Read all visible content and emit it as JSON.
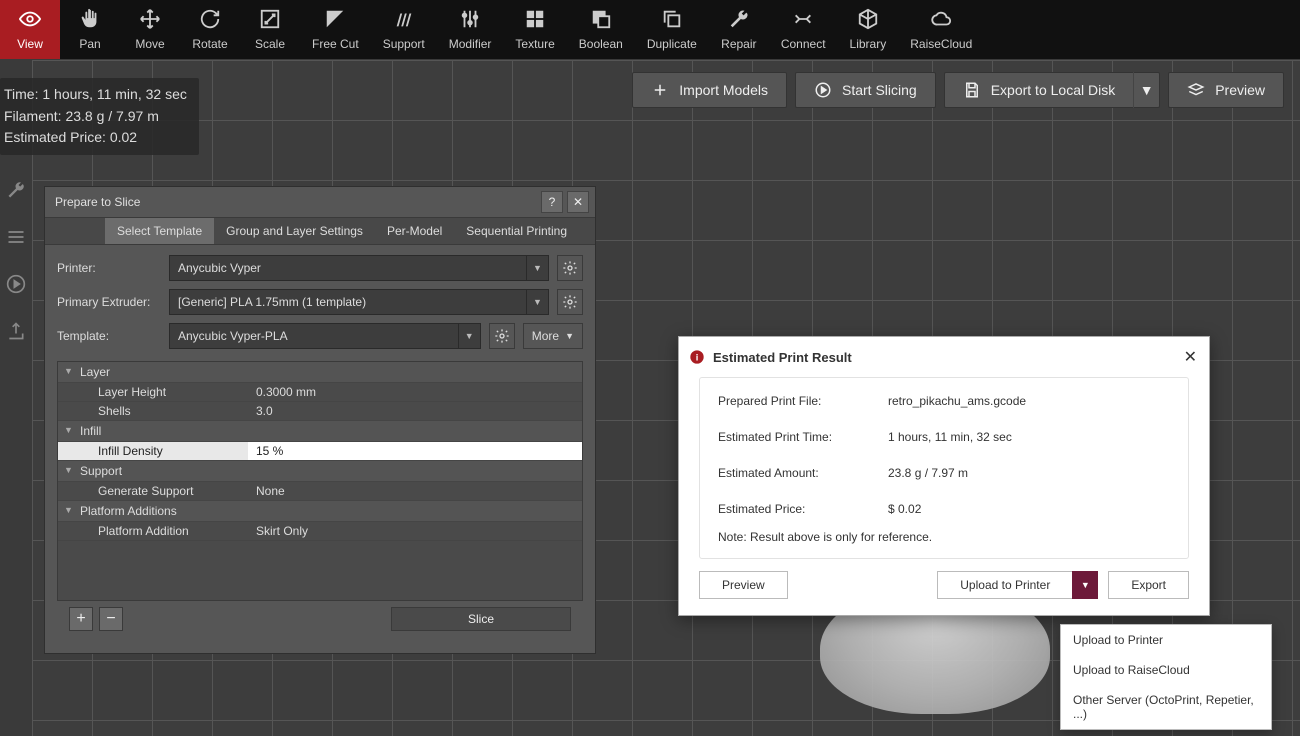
{
  "toolbar": [
    {
      "id": "view",
      "label": "View"
    },
    {
      "id": "pan",
      "label": "Pan"
    },
    {
      "id": "move",
      "label": "Move"
    },
    {
      "id": "rotate",
      "label": "Rotate"
    },
    {
      "id": "scale",
      "label": "Scale"
    },
    {
      "id": "freecut",
      "label": "Free Cut"
    },
    {
      "id": "support",
      "label": "Support"
    },
    {
      "id": "modifier",
      "label": "Modifier"
    },
    {
      "id": "texture",
      "label": "Texture"
    },
    {
      "id": "boolean",
      "label": "Boolean"
    },
    {
      "id": "duplicate",
      "label": "Duplicate"
    },
    {
      "id": "repair",
      "label": "Repair"
    },
    {
      "id": "connect",
      "label": "Connect"
    },
    {
      "id": "library",
      "label": "Library"
    },
    {
      "id": "raisecloud",
      "label": "RaiseCloud"
    }
  ],
  "info": {
    "time": "Time: 1 hours, 11 min, 32 sec",
    "filament": "Filament: 23.8 g / 7.97 m",
    "price": "Estimated Price: 0.02"
  },
  "actions": {
    "import": "Import Models",
    "slice": "Start Slicing",
    "export": "Export to Local Disk",
    "preview": "Preview"
  },
  "panel": {
    "title": "Prepare to Slice",
    "tabs": {
      "select": "Select Template",
      "group": "Group and Layer Settings",
      "permodel": "Per-Model",
      "sequential": "Sequential Printing"
    },
    "labels": {
      "printer": "Printer:",
      "extruder": "Primary Extruder:",
      "template": "Template:"
    },
    "values": {
      "printer": "Anycubic Vyper",
      "extruder": "[Generic] PLA 1.75mm (1 template)",
      "template": "Anycubic Vyper-PLA"
    },
    "more": "More",
    "groups": {
      "layer": "Layer",
      "infill": "Infill",
      "support": "Support",
      "platform": "Platform Additions"
    },
    "props": {
      "layerHeight_k": "Layer Height",
      "layerHeight_v": "0.3000 mm",
      "shells_k": "Shells",
      "shells_v": "3.0",
      "infillDensity_k": "Infill Density",
      "infillDensity_v": "15 %",
      "generateSupport_k": "Generate Support",
      "generateSupport_v": "None",
      "platformAdd_k": "Platform Addition",
      "platformAdd_v": "Skirt Only"
    },
    "sliceBtn": "Slice"
  },
  "result": {
    "title": "Estimated Print Result",
    "rows": {
      "file_k": "Prepared Print File:",
      "file_v": "retro_pikachu_ams.gcode",
      "time_k": "Estimated Print Time:",
      "time_v": "1 hours, 11 min, 32 sec",
      "amount_k": "Estimated Amount:",
      "amount_v": "23.8 g / 7.97 m",
      "price_k": "Estimated Price:",
      "price_v": "$ 0.02"
    },
    "note": "Note: Result above is only for reference.",
    "buttons": {
      "preview": "Preview",
      "upload": "Upload to Printer",
      "export": "Export"
    }
  },
  "uploadMenu": {
    "printer": "Upload to Printer",
    "cloud": "Upload to RaiseCloud",
    "other": "Other Server (OctoPrint, Repetier, ...)"
  }
}
